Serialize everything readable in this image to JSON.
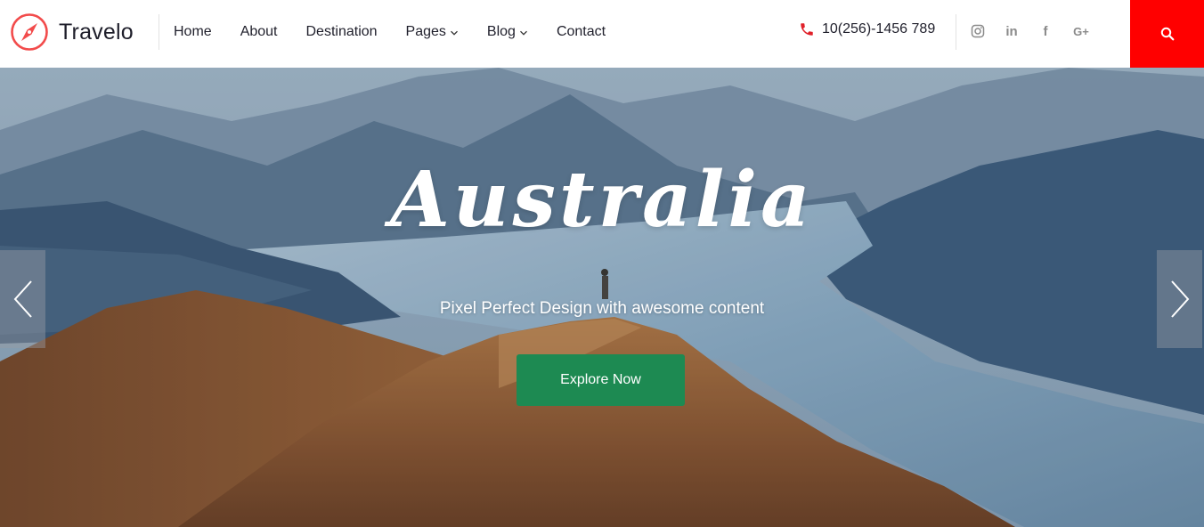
{
  "brand": {
    "name": "Travelo",
    "logo_icon": "compass-icon",
    "accent": "#f24b4b"
  },
  "nav": {
    "items": [
      {
        "label": "Home",
        "dropdown": false
      },
      {
        "label": "About",
        "dropdown": false
      },
      {
        "label": "Destination",
        "dropdown": false
      },
      {
        "label": "Pages",
        "dropdown": true
      },
      {
        "label": "Blog",
        "dropdown": true
      },
      {
        "label": "Contact",
        "dropdown": false
      }
    ]
  },
  "contact": {
    "phone": "10(256)-1456 789",
    "phone_icon": "phone-icon",
    "phone_icon_color": "#e0212a"
  },
  "socials": [
    {
      "name": "instagram-icon"
    },
    {
      "name": "linkedin-icon",
      "glyph": "in"
    },
    {
      "name": "facebook-icon",
      "glyph": "f"
    },
    {
      "name": "google-plus-icon",
      "glyph": "G+"
    }
  ],
  "search": {
    "icon": "search-icon",
    "bg_color": "#ff0000"
  },
  "hero": {
    "title": "Australia",
    "subtitle": "Pixel Perfect Design with awesome content",
    "cta_label": "Explore Now",
    "cta_color": "#1d8a52",
    "prev_icon": "chevron-left-icon",
    "next_icon": "chevron-right-icon"
  }
}
